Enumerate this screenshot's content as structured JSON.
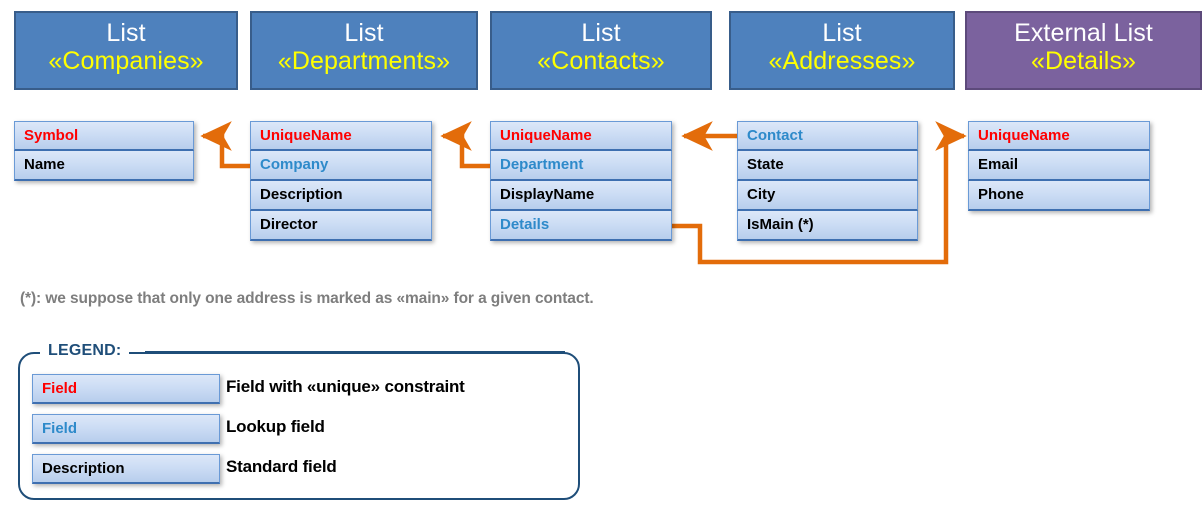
{
  "diagram": {
    "colors": {
      "list_header_fill": "#4E81BD",
      "list_header_border": "#385D8A",
      "external_header_fill": "#7B629E",
      "external_header_border": "#5D4A7B",
      "stereotype_text": "#FFFF00",
      "connector": "#E36C0A",
      "unique_field_text": "#FF0000",
      "lookup_field_text": "#2E8ACA",
      "standard_field_text": "#000000",
      "field_fill_top": "#DCE7F8",
      "field_fill_bottom": "#B7CDEC",
      "legend_border": "#1F4E79",
      "footnote_text": "#7E7E7E"
    },
    "lists": [
      {
        "kind": "List",
        "stereotype": "«Companies»",
        "external": false,
        "fields": [
          {
            "label": "Symbol",
            "type": "unique"
          },
          {
            "label": "Name",
            "type": "standard"
          }
        ]
      },
      {
        "kind": "List",
        "stereotype": "«Departments»",
        "external": false,
        "fields": [
          {
            "label": "UniqueName",
            "type": "unique"
          },
          {
            "label": "Company",
            "type": "lookup"
          },
          {
            "label": "Description",
            "type": "standard"
          },
          {
            "label": "Director",
            "type": "standard"
          }
        ]
      },
      {
        "kind": "List",
        "stereotype": "«Contacts»",
        "external": false,
        "fields": [
          {
            "label": "UniqueName",
            "type": "unique"
          },
          {
            "label": "Department",
            "type": "lookup"
          },
          {
            "label": "DisplayName",
            "type": "standard"
          },
          {
            "label": "Details",
            "type": "lookup"
          }
        ]
      },
      {
        "kind": "List",
        "stereotype": "«Addresses»",
        "external": false,
        "fields": [
          {
            "label": "Contact",
            "type": "lookup"
          },
          {
            "label": "State",
            "type": "standard"
          },
          {
            "label": "City",
            "type": "standard"
          },
          {
            "label": "IsMain (*)",
            "type": "standard"
          }
        ]
      },
      {
        "kind": "External List",
        "stereotype": "«Details»",
        "external": true,
        "fields": [
          {
            "label": "UniqueName",
            "type": "unique"
          },
          {
            "label": "Email",
            "type": "standard"
          },
          {
            "label": "Phone",
            "type": "standard"
          }
        ]
      }
    ],
    "relations": [
      {
        "from": "Departments.Company",
        "to": "Companies.Symbol"
      },
      {
        "from": "Contacts.Department",
        "to": "Departments.UniqueName"
      },
      {
        "from": "Addresses.Contact",
        "to": "Contacts.UniqueName"
      },
      {
        "from": "Contacts.Details",
        "to": "Details.UniqueName"
      }
    ]
  },
  "footnote": "(*): we suppose that only one address is marked as «main» for a given contact.",
  "legend": {
    "title": "LEGEND:",
    "rows": [
      {
        "chip": "Field",
        "type": "unique",
        "description": "Field with «unique» constraint"
      },
      {
        "chip": "Field",
        "type": "lookup",
        "description": "Lookup field"
      },
      {
        "chip": "Description",
        "type": "standard",
        "description": "Standard field"
      }
    ]
  }
}
